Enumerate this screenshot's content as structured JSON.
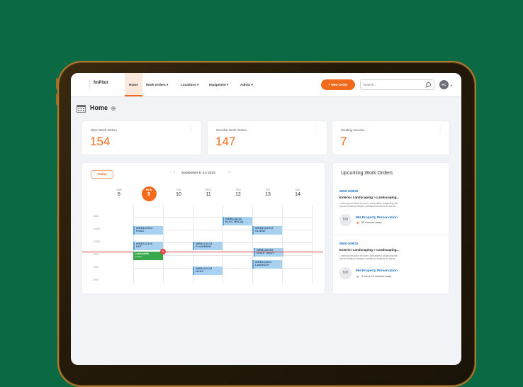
{
  "brand": {
    "logo": "fmPilot",
    "accent": "#f26b1d",
    "link": "#1c72c4"
  },
  "nav": {
    "tabs": [
      {
        "label": "Home"
      },
      {
        "label": "Work Orders ▾"
      },
      {
        "label": "Locations ▾"
      },
      {
        "label": "Equipment ▾"
      },
      {
        "label": "Admin ▾"
      }
    ],
    "new_order": "+ New Order",
    "search_placeholder": "Search...",
    "user_initials": "FC"
  },
  "page": {
    "title": "Home"
  },
  "stats": [
    {
      "label": "Open Work Orders",
      "value": "154"
    },
    {
      "label": "Overdue Work Orders",
      "value": "147"
    },
    {
      "label": "Pending Invoices",
      "value": "7"
    }
  ],
  "calendar": {
    "today_label": "Today",
    "week_label": "September 8 -14 2019",
    "days": [
      {
        "name": "SUN",
        "num": "8"
      },
      {
        "name": "MON",
        "num": "9"
      },
      {
        "name": "TUE",
        "num": "10"
      },
      {
        "name": "WED",
        "num": "11"
      },
      {
        "name": "THU",
        "num": "12"
      },
      {
        "name": "FRI",
        "num": "13"
      },
      {
        "name": "SAT",
        "num": "14"
      }
    ],
    "times": [
      "8AM",
      "10AM",
      "12PM",
      "2PM",
      "4PM",
      "6PM"
    ],
    "events": [
      {
        "line1": "WEB112312",
        "line2": "HVAC"
      },
      {
        "line1": "WEB112416",
        "line2": "EXT"
      },
      {
        "line1": "WEB112614",
        "line2": "PLUMBING"
      },
      {
        "line1": "WEB113242",
        "line2": "ELECTRICAL"
      },
      {
        "line1": "WEB1162012",
        "line2": "CLIENT"
      },
      {
        "line1": "WEB132152",
        "line2": "GOLF TECH"
      },
      {
        "line1": "WEB113312",
        "line2": "LANDSCP"
      },
      {
        "line1": "WEB112322",
        "line2": "HVAC"
      }
    ],
    "current": {
      "line1": "Locksmith",
      "line2": "2:15pm",
      "badge": "2"
    }
  },
  "upcoming": {
    "title": "Upcoming Work Orders",
    "items": [
      {
        "number": "WEB-109532",
        "title": "Exterior Landscaping  >  Landscaping...",
        "desc1": "Lorem ipsum dolor sit amet, consectetur adipiscing elit,",
        "desc2": "sed do eiusmod tempor incididunt ut labore et dolore...",
        "initials": "MH",
        "property": "MH Property Preservation",
        "eta": "35 minutes away"
      },
      {
        "number": "WEB-109532",
        "title": "Exterior Landscaping  >  Landscaping...",
        "desc1": "Lorem ipsum dolor sit amet, consectetur adipiscing elit,",
        "desc2": "sed do eiusmod tempor incididunt ut labore et dolore...",
        "initials": "MH",
        "property": "MH Property Preservation",
        "eta": "4 hours 15 minutes away"
      }
    ]
  }
}
